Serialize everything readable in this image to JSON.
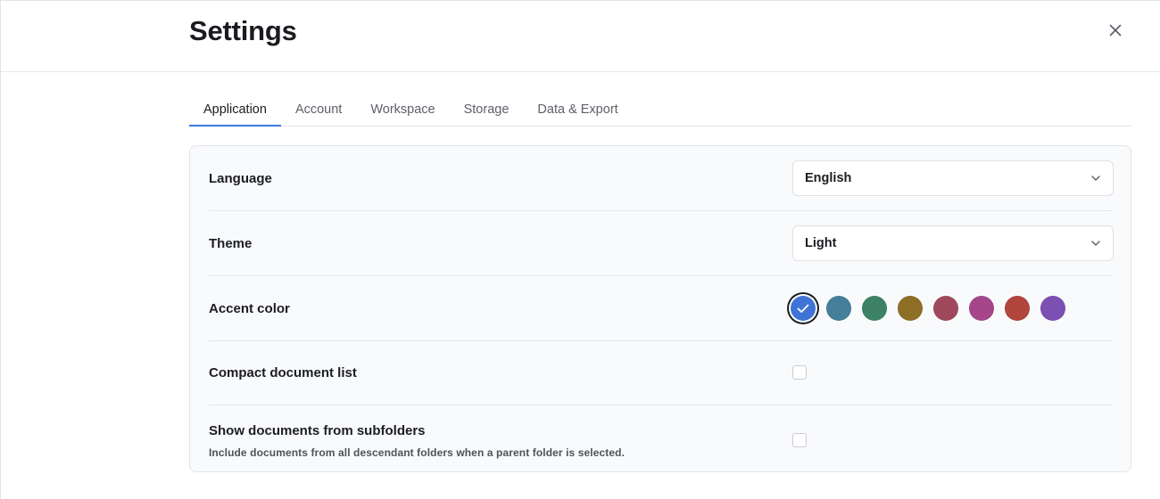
{
  "header": {
    "title": "Settings"
  },
  "tabs": [
    {
      "label": "Application",
      "active": true
    },
    {
      "label": "Account",
      "active": false
    },
    {
      "label": "Workspace",
      "active": false
    },
    {
      "label": "Storage",
      "active": false
    },
    {
      "label": "Data & Export",
      "active": false
    }
  ],
  "settings": {
    "language": {
      "label": "Language",
      "value": "English"
    },
    "theme": {
      "label": "Theme",
      "value": "Light"
    },
    "accent": {
      "label": "Accent color",
      "selected_index": 0,
      "colors": [
        "#3f74d6",
        "#457f9a",
        "#3d8266",
        "#8e6f26",
        "#a1495c",
        "#a5468b",
        "#b2453d",
        "#7c4fb3"
      ]
    },
    "compact": {
      "label": "Compact document list",
      "checked": false
    },
    "subfolders": {
      "label": "Show documents from subfolders",
      "description": "Include documents from all descendant folders when a parent folder is selected.",
      "checked": false
    }
  },
  "icons": {
    "close": "close-icon",
    "chevron": "chevron-down-icon",
    "check": "check-icon"
  }
}
